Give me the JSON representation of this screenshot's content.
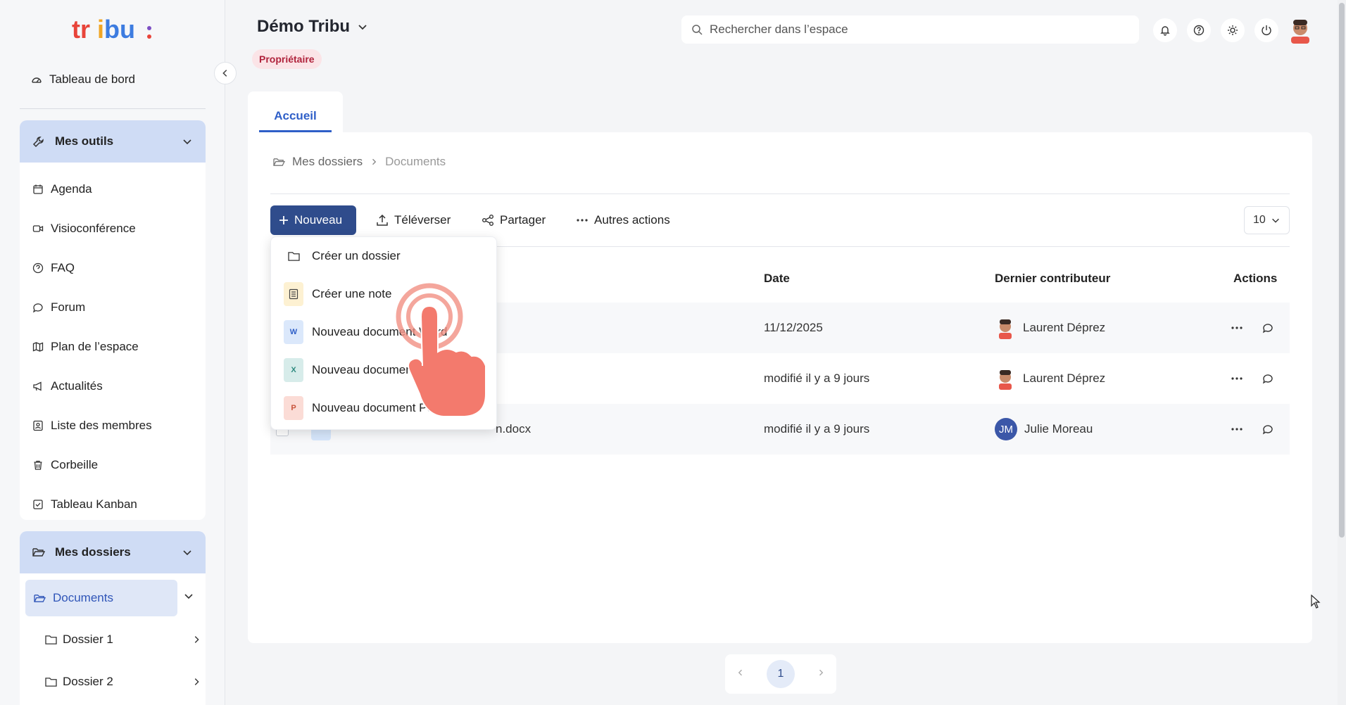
{
  "sidebar": {
    "logo_text": "tribu:",
    "dashboard_label": "Tableau de bord",
    "tools_header": "Mes outils",
    "tools": [
      {
        "label": "Agenda",
        "icon": "calendar-icon"
      },
      {
        "label": "Visioconférence",
        "icon": "video-icon"
      },
      {
        "label": "FAQ",
        "icon": "help-circle-icon"
      },
      {
        "label": "Forum",
        "icon": "chat-bubble-icon"
      },
      {
        "label": "Plan de l’espace",
        "icon": "map-icon"
      },
      {
        "label": "Actualités",
        "icon": "megaphone-icon"
      },
      {
        "label": "Liste des membres",
        "icon": "contacts-icon"
      },
      {
        "label": "Corbeille",
        "icon": "trash-icon"
      },
      {
        "label": "Tableau Kanban",
        "icon": "checkbox-icon"
      }
    ],
    "folders_header": "Mes dossiers",
    "documents_label": "Documents",
    "subfolders": [
      "Dossier 1",
      "Dossier 2"
    ]
  },
  "header": {
    "space_name": "Démo Tribu",
    "role": "Propriétaire",
    "search_placeholder": "Rechercher dans l’espace"
  },
  "tabs": [
    "Accueil"
  ],
  "breadcrumb": [
    "Mes dossiers",
    "Documents"
  ],
  "toolbar": {
    "new_label": "Nouveau",
    "upload_label": "Téléverser",
    "share_label": "Partager",
    "more_label": "Autres actions",
    "per_page": "10"
  },
  "table": {
    "columns": {
      "date": "Date",
      "contributor": "Dernier contributeur",
      "actions": "Actions"
    },
    "rows": [
      {
        "name": "",
        "date": "11/12/2025",
        "contributor": "Laurent Déprez",
        "initials": ""
      },
      {
        "name": "",
        "date": "modifié il y a 9 jours",
        "contributor": "Laurent Déprez",
        "initials": ""
      },
      {
        "name": "n.docx",
        "date": "modifié il y a 9 jours",
        "contributor": "Julie Moreau",
        "initials": "JM"
      }
    ]
  },
  "new_menu": [
    {
      "label": "Créer un dossier",
      "badge": "",
      "color": "#ffffff"
    },
    {
      "label": "Créer une note",
      "badge": "",
      "color": "#fdf1d2"
    },
    {
      "label": "Nouveau document Word",
      "badge": "W",
      "color": "#dbe8fb"
    },
    {
      "label": "Nouveau document Excel",
      "badge": "X",
      "color": "#d7ecea"
    },
    {
      "label": "Nouveau document PowerPoint",
      "badge": "P",
      "color": "#fbdcd6"
    }
  ],
  "pagination": {
    "current": "1"
  },
  "colors": {
    "accent": "#2f4c8c",
    "active_blue": "#2f5fc8",
    "role_bg": "#fbe4e7",
    "role_text": "#b0233c"
  }
}
